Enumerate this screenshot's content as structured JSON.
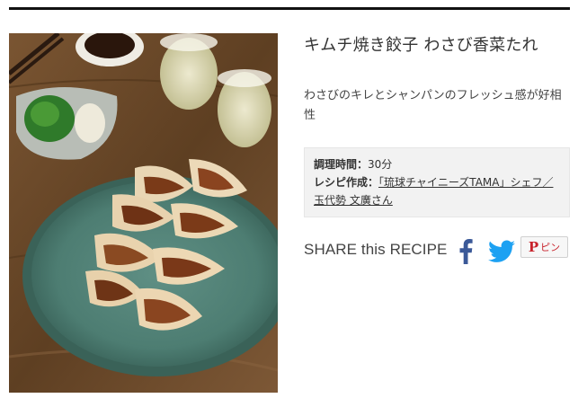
{
  "recipe": {
    "title": "キムチ焼き餃子 わさび香菜たれ",
    "description": "わさびのキレとシャンパンのフレッシュ感が好相性",
    "photo_alt": "キムチ焼き餃子 わさび香菜たれ",
    "cooking_time_label": "調理時間：",
    "cooking_time_value": "30分",
    "author_label": "レシピ作成：",
    "author_link": "「琉球チャイニーズTAMA」シェフ／玉代勢 文廣さん"
  },
  "share": {
    "label": "SHARE this RECIPE",
    "pinterest_label": "ピン"
  },
  "colors": {
    "facebook": "#3b5998",
    "twitter": "#1da1f2",
    "pinterest": "#c8232c",
    "info_bg": "#f2f2f2"
  },
  "icons": {
    "facebook": "facebook-icon",
    "twitter": "twitter-icon",
    "pinterest": "pinterest-icon"
  }
}
